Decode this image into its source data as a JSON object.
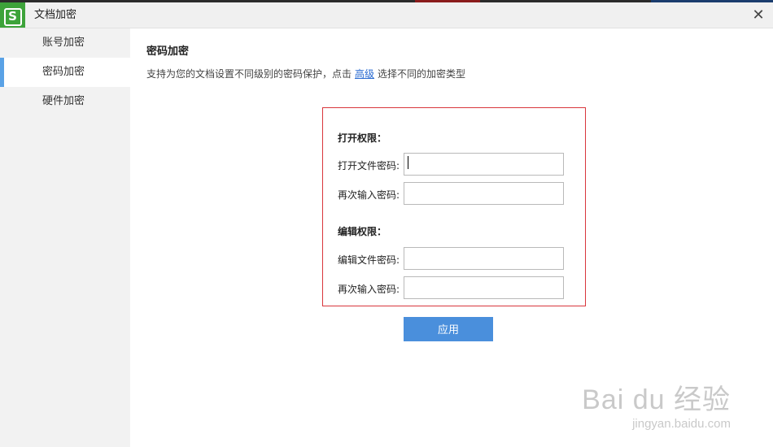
{
  "window": {
    "title": "文档加密",
    "app_icon": "S",
    "close_symbol": "✕"
  },
  "sidebar": {
    "items": [
      {
        "label": "账号加密",
        "active": false
      },
      {
        "label": "密码加密",
        "active": true
      },
      {
        "label": "硬件加密",
        "active": false
      }
    ]
  },
  "main": {
    "title": "密码加密",
    "desc_before": "支持为您的文档设置不同级别的密码保护，点击",
    "desc_link": "高级",
    "desc_after": "选择不同的加密类型"
  },
  "open_section": {
    "heading": "打开权限：",
    "password_label": "打开文件密码:",
    "confirm_label": "再次输入密码:",
    "password_value": "",
    "confirm_value": ""
  },
  "edit_section": {
    "heading": "编辑权限：",
    "password_label": "编辑文件密码:",
    "confirm_label": "再次输入密码:",
    "password_value": "",
    "confirm_value": ""
  },
  "apply_label": "应用",
  "watermark": {
    "logo": "Bai du 经验",
    "url": "jingyan.baidu.com"
  },
  "colors": {
    "accent": "#4a8fdc",
    "highlight_border": "#d9363c",
    "app_icon_bg": "#3da33a",
    "active_marker": "#5aa2e6"
  }
}
